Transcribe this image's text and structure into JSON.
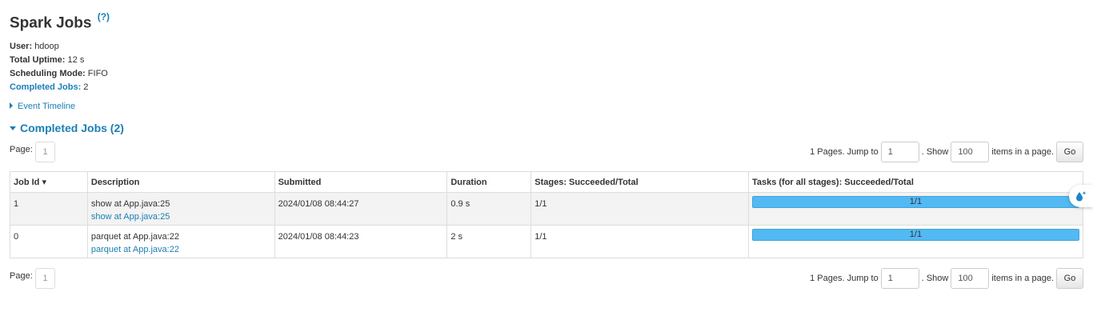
{
  "header": {
    "title": "Spark Jobs",
    "help": "(?)"
  },
  "summary": {
    "user_label": "User:",
    "user": "hdoop",
    "uptime_label": "Total Uptime:",
    "uptime": "12 s",
    "sched_label": "Scheduling Mode:",
    "sched": "FIFO",
    "completed_label": "Completed Jobs:",
    "completed": "2"
  },
  "timeline": {
    "label": "Event Timeline"
  },
  "section": {
    "title": "Completed Jobs (2)"
  },
  "pager": {
    "page_label": "Page:",
    "current_page": "1",
    "pages_text": "1 Pages. Jump to",
    "jump_value": "1",
    "show_text": ". Show",
    "size_value": "100",
    "items_text": "items in a page.",
    "go_label": "Go"
  },
  "table": {
    "headers": [
      "Job Id ▾",
      "Description",
      "Submitted",
      "Duration",
      "Stages: Succeeded/Total",
      "Tasks (for all stages): Succeeded/Total"
    ],
    "rows": [
      {
        "id": "1",
        "desc": "show at App.java:25",
        "desc_link": "show at App.java:25",
        "submitted": "2024/01/08 08:44:27",
        "duration": "0.9 s",
        "stages": "1/1",
        "tasks": "1/1",
        "progress": 1.0
      },
      {
        "id": "0",
        "desc": "parquet at App.java:22",
        "desc_link": "parquet at App.java:22",
        "submitted": "2024/01/08 08:44:23",
        "duration": "2 s",
        "stages": "1/1",
        "tasks": "1/1",
        "progress": 1.0
      }
    ]
  },
  "colors": {
    "link": "#1a7fb5",
    "progress": "#4ab2ec",
    "row_alt": "#f3f3f3"
  },
  "icons": {
    "floating": "droplet-sparkle-icon"
  }
}
